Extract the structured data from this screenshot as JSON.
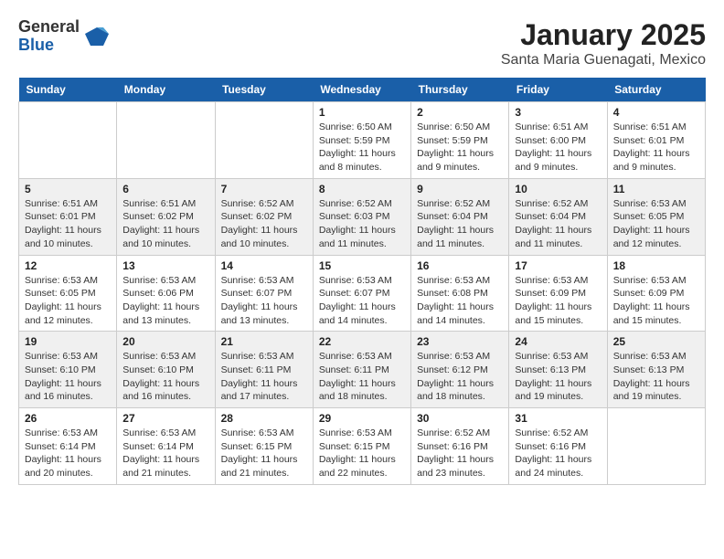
{
  "logo": {
    "general": "General",
    "blue": "Blue"
  },
  "title": "January 2025",
  "location": "Santa Maria Guenagati, Mexico",
  "days_of_week": [
    "Sunday",
    "Monday",
    "Tuesday",
    "Wednesday",
    "Thursday",
    "Friday",
    "Saturday"
  ],
  "weeks": [
    {
      "days": [
        {
          "num": "",
          "info": ""
        },
        {
          "num": "",
          "info": ""
        },
        {
          "num": "",
          "info": ""
        },
        {
          "num": "1",
          "info": "Sunrise: 6:50 AM\nSunset: 5:59 PM\nDaylight: 11 hours and 8 minutes."
        },
        {
          "num": "2",
          "info": "Sunrise: 6:50 AM\nSunset: 5:59 PM\nDaylight: 11 hours and 9 minutes."
        },
        {
          "num": "3",
          "info": "Sunrise: 6:51 AM\nSunset: 6:00 PM\nDaylight: 11 hours and 9 minutes."
        },
        {
          "num": "4",
          "info": "Sunrise: 6:51 AM\nSunset: 6:01 PM\nDaylight: 11 hours and 9 minutes."
        }
      ]
    },
    {
      "days": [
        {
          "num": "5",
          "info": "Sunrise: 6:51 AM\nSunset: 6:01 PM\nDaylight: 11 hours and 10 minutes."
        },
        {
          "num": "6",
          "info": "Sunrise: 6:51 AM\nSunset: 6:02 PM\nDaylight: 11 hours and 10 minutes."
        },
        {
          "num": "7",
          "info": "Sunrise: 6:52 AM\nSunset: 6:02 PM\nDaylight: 11 hours and 10 minutes."
        },
        {
          "num": "8",
          "info": "Sunrise: 6:52 AM\nSunset: 6:03 PM\nDaylight: 11 hours and 11 minutes."
        },
        {
          "num": "9",
          "info": "Sunrise: 6:52 AM\nSunset: 6:04 PM\nDaylight: 11 hours and 11 minutes."
        },
        {
          "num": "10",
          "info": "Sunrise: 6:52 AM\nSunset: 6:04 PM\nDaylight: 11 hours and 11 minutes."
        },
        {
          "num": "11",
          "info": "Sunrise: 6:53 AM\nSunset: 6:05 PM\nDaylight: 11 hours and 12 minutes."
        }
      ]
    },
    {
      "days": [
        {
          "num": "12",
          "info": "Sunrise: 6:53 AM\nSunset: 6:05 PM\nDaylight: 11 hours and 12 minutes."
        },
        {
          "num": "13",
          "info": "Sunrise: 6:53 AM\nSunset: 6:06 PM\nDaylight: 11 hours and 13 minutes."
        },
        {
          "num": "14",
          "info": "Sunrise: 6:53 AM\nSunset: 6:07 PM\nDaylight: 11 hours and 13 minutes."
        },
        {
          "num": "15",
          "info": "Sunrise: 6:53 AM\nSunset: 6:07 PM\nDaylight: 11 hours and 14 minutes."
        },
        {
          "num": "16",
          "info": "Sunrise: 6:53 AM\nSunset: 6:08 PM\nDaylight: 11 hours and 14 minutes."
        },
        {
          "num": "17",
          "info": "Sunrise: 6:53 AM\nSunset: 6:09 PM\nDaylight: 11 hours and 15 minutes."
        },
        {
          "num": "18",
          "info": "Sunrise: 6:53 AM\nSunset: 6:09 PM\nDaylight: 11 hours and 15 minutes."
        }
      ]
    },
    {
      "days": [
        {
          "num": "19",
          "info": "Sunrise: 6:53 AM\nSunset: 6:10 PM\nDaylight: 11 hours and 16 minutes."
        },
        {
          "num": "20",
          "info": "Sunrise: 6:53 AM\nSunset: 6:10 PM\nDaylight: 11 hours and 16 minutes."
        },
        {
          "num": "21",
          "info": "Sunrise: 6:53 AM\nSunset: 6:11 PM\nDaylight: 11 hours and 17 minutes."
        },
        {
          "num": "22",
          "info": "Sunrise: 6:53 AM\nSunset: 6:11 PM\nDaylight: 11 hours and 18 minutes."
        },
        {
          "num": "23",
          "info": "Sunrise: 6:53 AM\nSunset: 6:12 PM\nDaylight: 11 hours and 18 minutes."
        },
        {
          "num": "24",
          "info": "Sunrise: 6:53 AM\nSunset: 6:13 PM\nDaylight: 11 hours and 19 minutes."
        },
        {
          "num": "25",
          "info": "Sunrise: 6:53 AM\nSunset: 6:13 PM\nDaylight: 11 hours and 19 minutes."
        }
      ]
    },
    {
      "days": [
        {
          "num": "26",
          "info": "Sunrise: 6:53 AM\nSunset: 6:14 PM\nDaylight: 11 hours and 20 minutes."
        },
        {
          "num": "27",
          "info": "Sunrise: 6:53 AM\nSunset: 6:14 PM\nDaylight: 11 hours and 21 minutes."
        },
        {
          "num": "28",
          "info": "Sunrise: 6:53 AM\nSunset: 6:15 PM\nDaylight: 11 hours and 21 minutes."
        },
        {
          "num": "29",
          "info": "Sunrise: 6:53 AM\nSunset: 6:15 PM\nDaylight: 11 hours and 22 minutes."
        },
        {
          "num": "30",
          "info": "Sunrise: 6:52 AM\nSunset: 6:16 PM\nDaylight: 11 hours and 23 minutes."
        },
        {
          "num": "31",
          "info": "Sunrise: 6:52 AM\nSunset: 6:16 PM\nDaylight: 11 hours and 24 minutes."
        },
        {
          "num": "",
          "info": ""
        }
      ]
    }
  ]
}
